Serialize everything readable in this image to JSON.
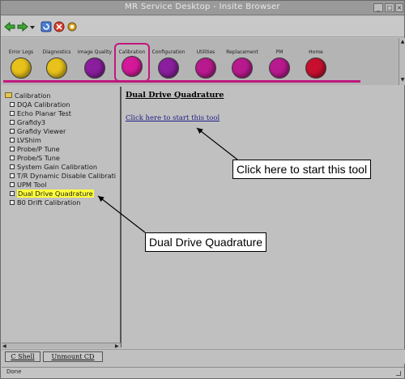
{
  "window": {
    "title": "MR Service Desktop - Insite  Browser"
  },
  "tabs": [
    {
      "label": "Error Logs",
      "icon": "error-logs-icon",
      "color": "#e8c21a"
    },
    {
      "label": "Diagnostics",
      "icon": "diagnostics-icon",
      "color": "#e8c21a"
    },
    {
      "label": "Image Quality",
      "icon": "image-quality-icon",
      "color": "#8a1e9e"
    },
    {
      "label": "Calibration",
      "icon": "calibration-icon",
      "color": "#d4199a"
    },
    {
      "label": "Configuration",
      "icon": "configuration-icon",
      "color": "#8a1e9e"
    },
    {
      "label": "Utilities",
      "icon": "utilities-icon",
      "color": "#b81a8e"
    },
    {
      "label": "Replacement",
      "icon": "replacement-icon",
      "color": "#b81a8e"
    },
    {
      "label": "PM",
      "icon": "pm-icon",
      "color": "#b81a8e"
    },
    {
      "label": "Home",
      "icon": "home-icon",
      "color": "#c8102e"
    }
  ],
  "accent": "#c0187e",
  "tree": {
    "root": "Calibration",
    "items": [
      {
        "label": "DQA Calibration"
      },
      {
        "label": "Echo Planar Test"
      },
      {
        "label": "Grafidy3"
      },
      {
        "label": "Grafidy Viewer"
      },
      {
        "label": "LVShim"
      },
      {
        "label": "Probe/P Tune"
      },
      {
        "label": "Probe/S Tune"
      },
      {
        "label": "System Gain Calibration"
      },
      {
        "label": "T/R Dynamic Disable Calibrati"
      },
      {
        "label": "UPM Tool"
      },
      {
        "label": "Dual Drive Quadrature",
        "selected": true
      },
      {
        "label": "B0 Drift Calibration"
      }
    ]
  },
  "content": {
    "heading": "Dual Drive Quadrature",
    "link": "Click here to start this tool"
  },
  "callouts": {
    "start_tool": "Click here to start this tool",
    "dual_drive": "Dual Drive Quadrature"
  },
  "bottom": {
    "c_shell": "C Shell",
    "unmount_cd": "Unmount CD"
  },
  "status": "Done"
}
